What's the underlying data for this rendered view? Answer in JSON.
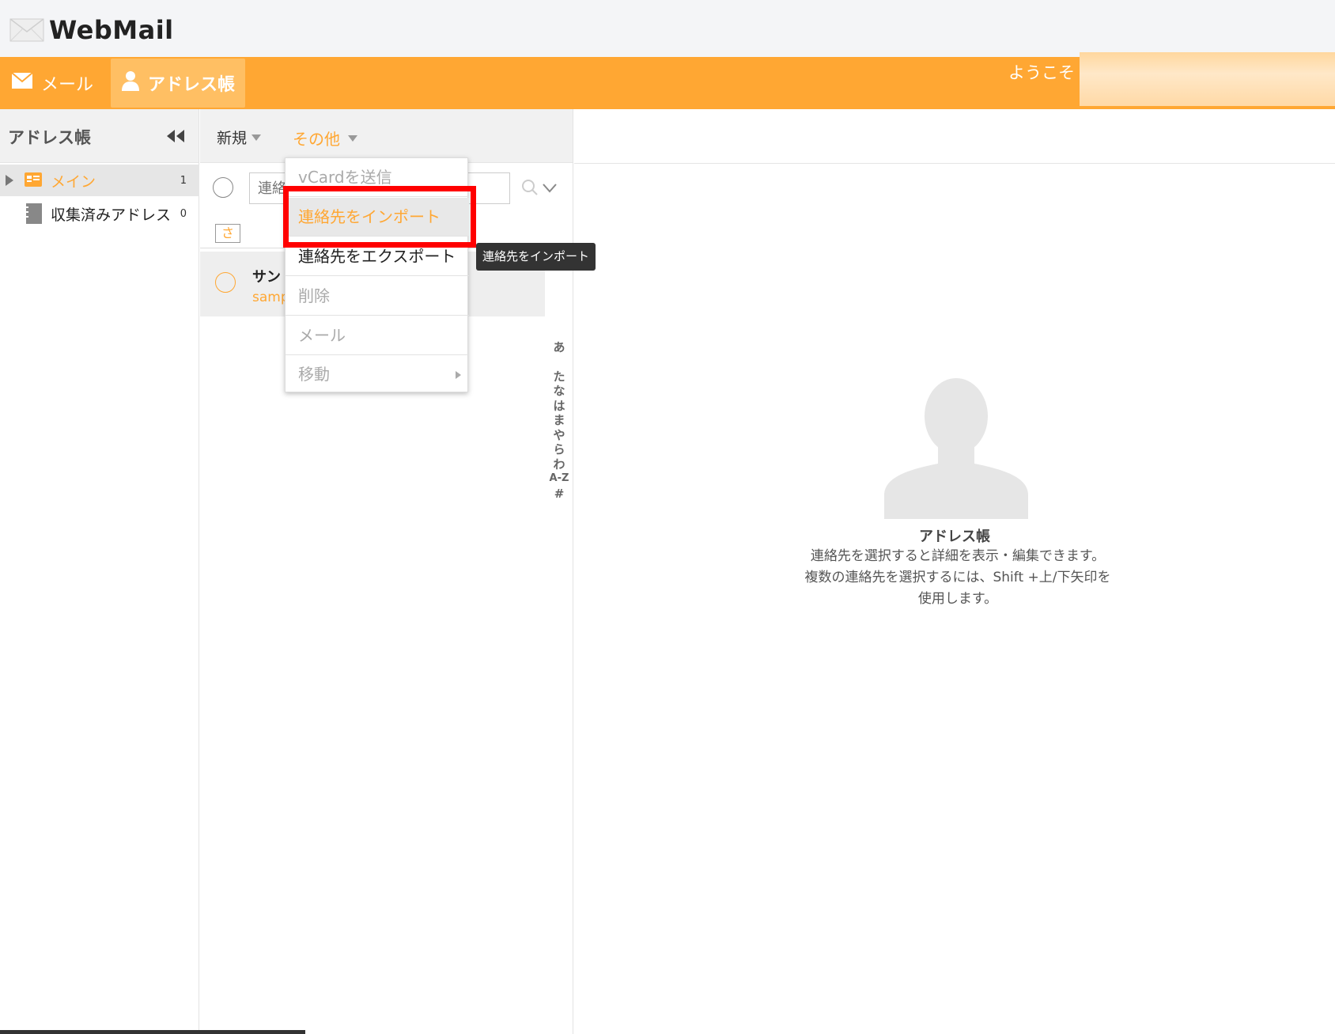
{
  "app": {
    "logo_text": "WebMail"
  },
  "nav": {
    "mail_label": "メール",
    "address_label": "アドレス帳",
    "welcome_text": "ようこそ"
  },
  "sidebar": {
    "title": "アドレス帳",
    "groups": [
      {
        "label": "メイン",
        "count": "1"
      },
      {
        "label": "収集済みアドレス",
        "count": "0"
      }
    ]
  },
  "toolbar": {
    "new_label": "新規",
    "other_label": "その他"
  },
  "search": {
    "placeholder": "連絡"
  },
  "list": {
    "letter": "さ",
    "contact": {
      "name": "サン",
      "email": "samp"
    },
    "index_letters": [
      "あ",
      "た",
      "な",
      "は",
      "ま",
      "や",
      "ら",
      "わ",
      "A-Z",
      "#"
    ]
  },
  "menu": {
    "items": [
      {
        "label": "vCardを送信"
      },
      {
        "label": "連絡先をインポート"
      },
      {
        "label": "連絡先をエクスポート"
      },
      {
        "label": "削除"
      },
      {
        "label": "メール"
      },
      {
        "label": "移動"
      }
    ],
    "tooltip": "連絡先をインポート"
  },
  "detail": {
    "title": "アドレス帳",
    "description": "連絡先を選択すると詳細を表示・編集できます。 複数の連絡先を選択するには、Shift +上/下矢印を使用します。"
  },
  "colors": {
    "accent": "#ffa733",
    "nav_active": "#ffbf63",
    "highlight": "#ff0000"
  }
}
